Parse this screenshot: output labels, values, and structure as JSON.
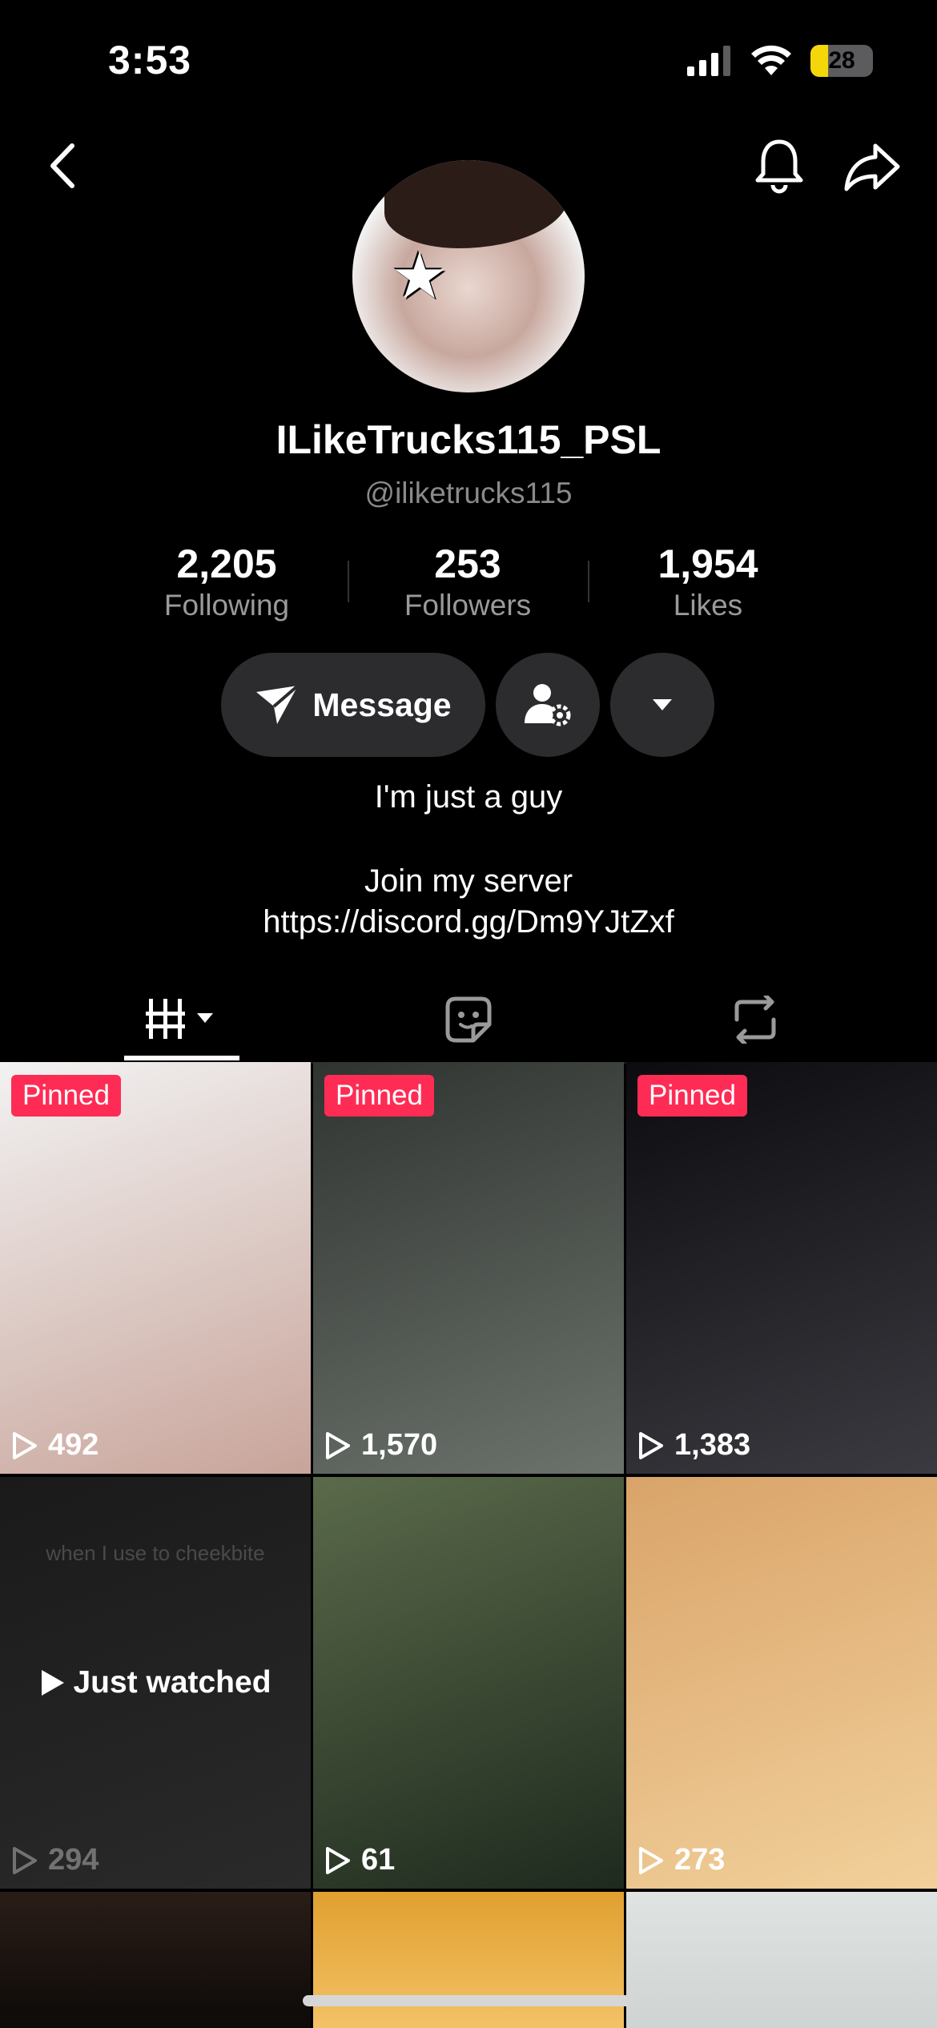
{
  "status_bar": {
    "time": "3:53",
    "battery": "28",
    "battery_level": 0.28
  },
  "profile": {
    "display_name": "ILikeTrucks115_PSL",
    "username": "@iliketrucks115",
    "stats": [
      {
        "value": "2,205",
        "label": "Following"
      },
      {
        "value": "253",
        "label": "Followers"
      },
      {
        "value": "1,954",
        "label": "Likes"
      }
    ],
    "message_label": "Message",
    "bio": [
      "I'm just a guy",
      "Join my server",
      "https://discord.gg/Dm9YJtZxf"
    ]
  },
  "tabs": [
    {
      "icon": "grid-icon",
      "active": true
    },
    {
      "icon": "sticker-icon",
      "active": false
    },
    {
      "icon": "repost-icon",
      "active": false
    }
  ],
  "videos": [
    {
      "pinned": "Pinned",
      "views": "492",
      "colors": [
        "#f2f2f2",
        "#c8a49a"
      ]
    },
    {
      "pinned": "Pinned",
      "views": "1,570",
      "colors": [
        "#2f3430",
        "#6c726c"
      ]
    },
    {
      "pinned": "Pinned",
      "views": "1,383",
      "colors": [
        "#0c0c10",
        "#3a3a40"
      ]
    },
    {
      "overlay": "when I use to cheekbite",
      "status": "Just watched",
      "views": "294",
      "colors": [
        "#1a1a1a",
        "#2a2a2a"
      ]
    },
    {
      "views": "61",
      "colors": [
        "#5a6a4a",
        "#1e2a1e"
      ]
    },
    {
      "views": "273",
      "colors": [
        "#d9a46a",
        "#f2d09a"
      ]
    }
  ]
}
